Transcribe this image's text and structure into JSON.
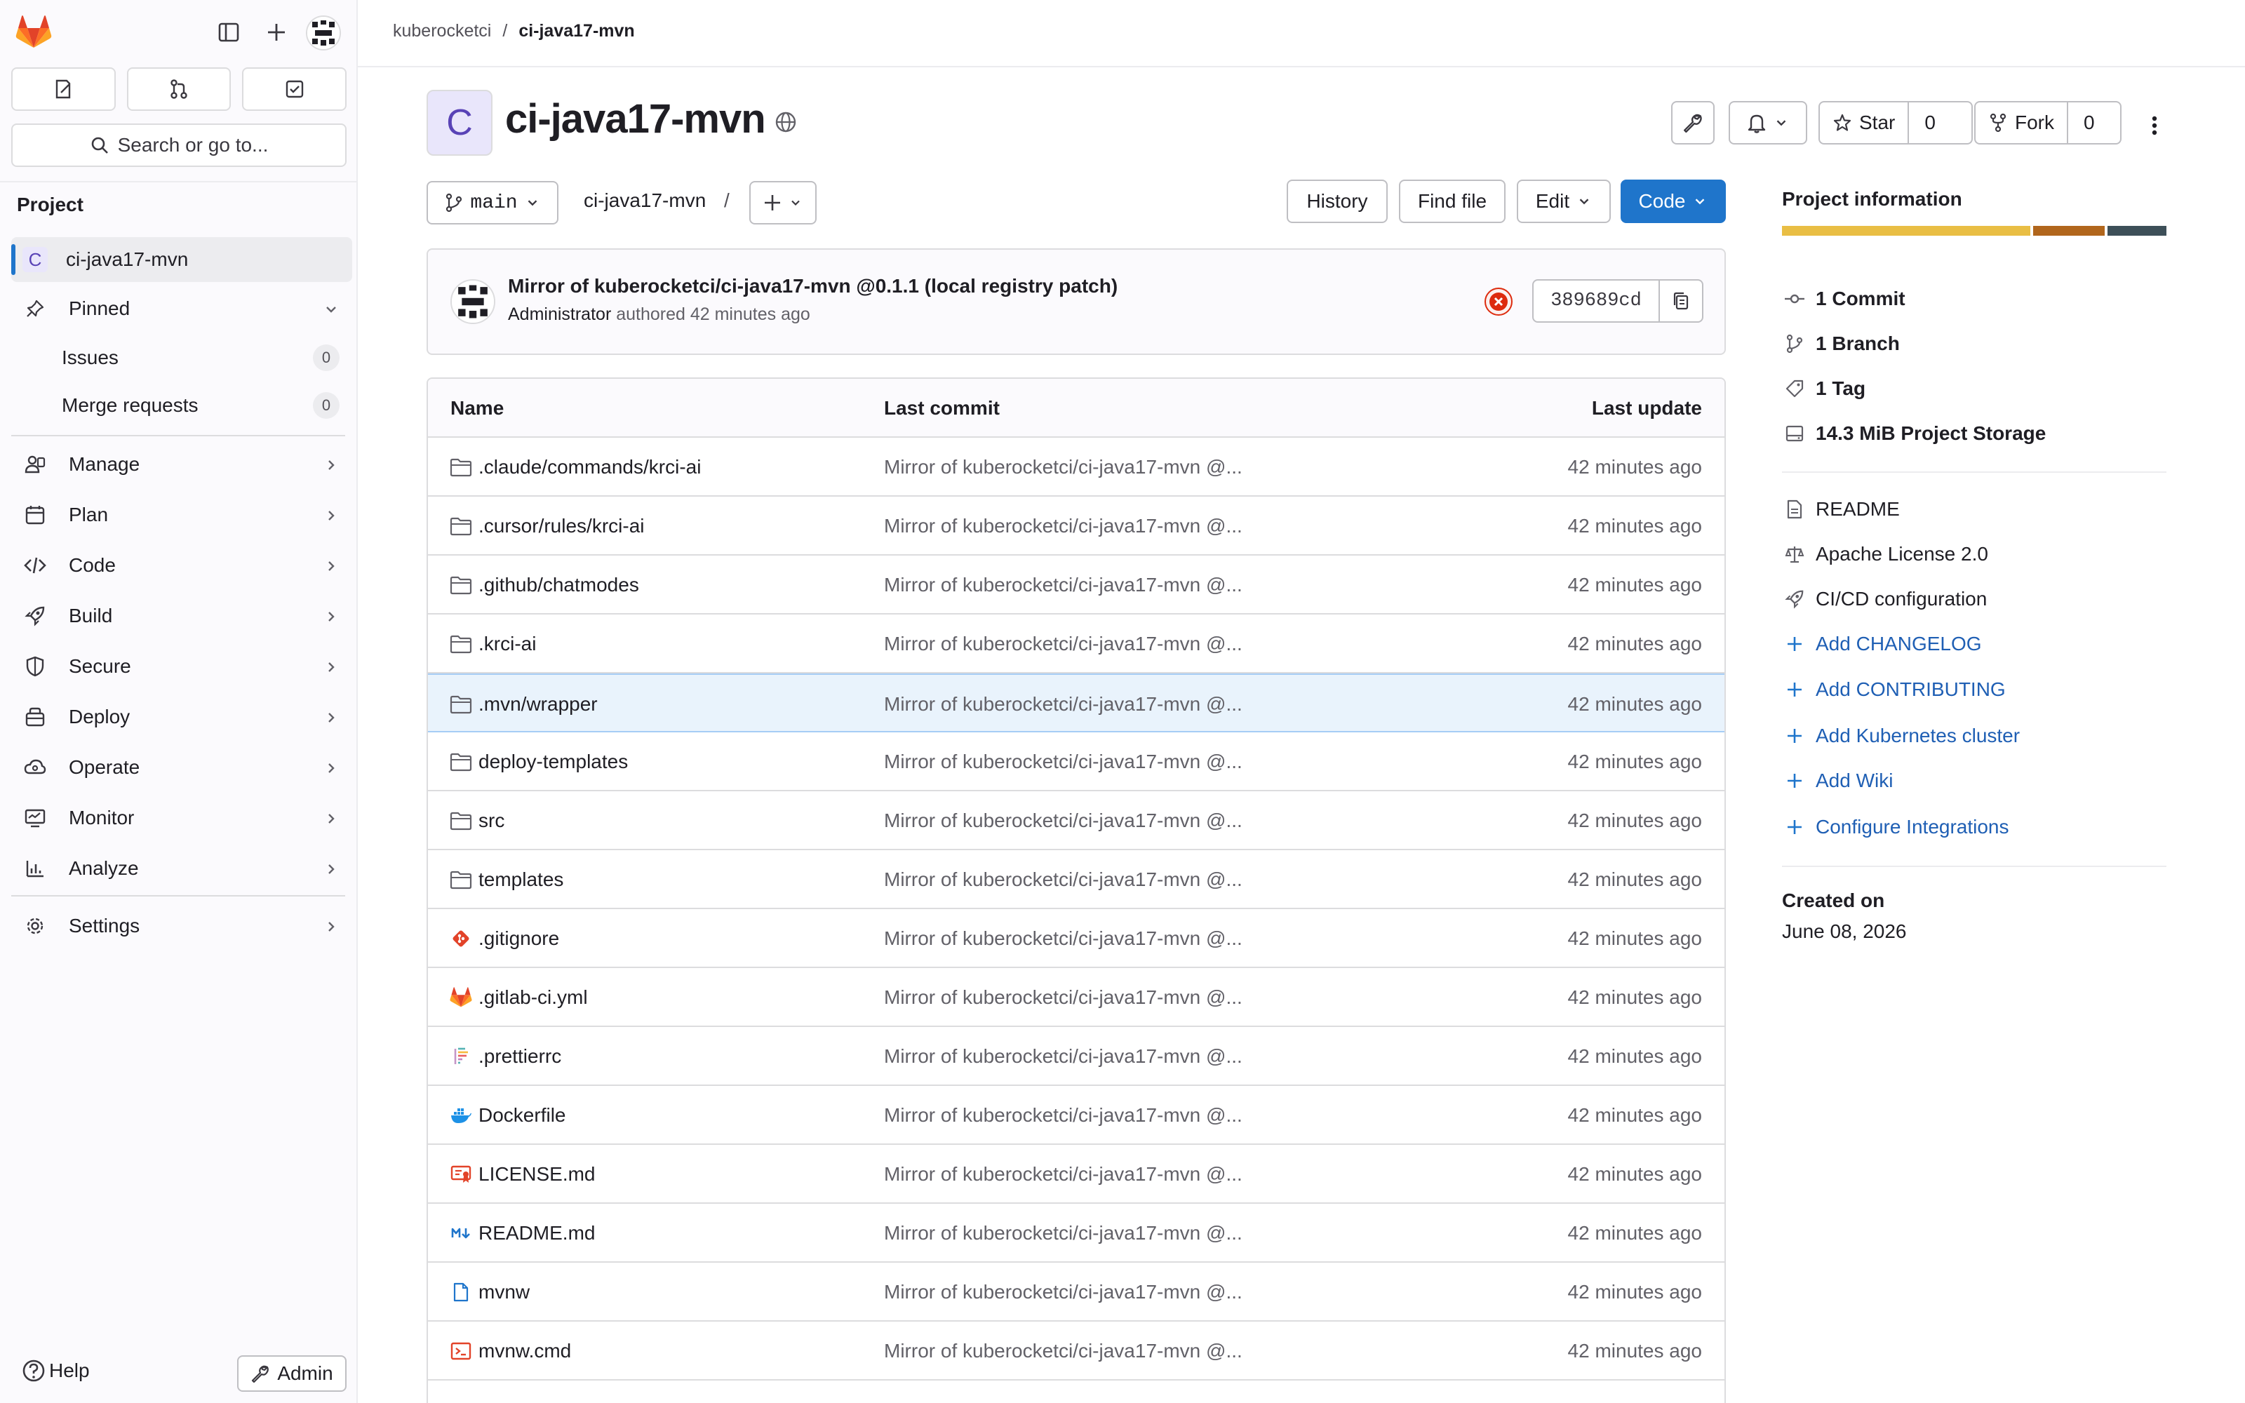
{
  "sidebar": {
    "search_label": "Search or go to...",
    "section_title": "Project",
    "project_initial": "C",
    "project_name": "ci-java17-mvn",
    "pinned_label": "Pinned",
    "pinned": [
      {
        "label": "Issues",
        "count": "0"
      },
      {
        "label": "Merge requests",
        "count": "0"
      }
    ],
    "nav": [
      {
        "label": "Manage",
        "icon": "users-icon"
      },
      {
        "label": "Plan",
        "icon": "calendar-icon"
      },
      {
        "label": "Code",
        "icon": "code-icon"
      },
      {
        "label": "Build",
        "icon": "rocket-icon"
      },
      {
        "label": "Secure",
        "icon": "shield-icon"
      },
      {
        "label": "Deploy",
        "icon": "deployments-icon"
      },
      {
        "label": "Operate",
        "icon": "cloud-gear-icon"
      },
      {
        "label": "Monitor",
        "icon": "monitor-icon"
      },
      {
        "label": "Analyze",
        "icon": "chart-icon"
      }
    ],
    "settings_label": "Settings",
    "help_label": "Help",
    "admin_label": "Admin"
  },
  "breadcrumb": {
    "group": "kuberocketci",
    "separator": "/",
    "project": "ci-java17-mvn"
  },
  "project": {
    "initial": "C",
    "title": "ci-java17-mvn",
    "star_label": "Star",
    "star_count": "0",
    "fork_label": "Fork",
    "fork_count": "0"
  },
  "toolbar": {
    "branch": "main",
    "path": "ci-java17-mvn",
    "path_sep": "/",
    "history": "History",
    "find_file": "Find file",
    "edit": "Edit",
    "code": "Code"
  },
  "commit": {
    "title": "Mirror of kuberocketci/ci-java17-mvn @0.1.1 (local registry patch)",
    "author": "Administrator",
    "meta": "authored 42 minutes ago",
    "sha": "389689cd",
    "status_color": "#dd2b0e"
  },
  "tree": {
    "headers": {
      "name": "Name",
      "last_commit": "Last commit",
      "last_update": "Last update"
    },
    "rows": [
      {
        "name": ".claude/commands/krci-ai",
        "icon": "folder-icon",
        "commit": "Mirror of kuberocketci/ci-java17-mvn @...",
        "updated": "42 minutes ago"
      },
      {
        "name": ".cursor/rules/krci-ai",
        "icon": "folder-icon",
        "commit": "Mirror of kuberocketci/ci-java17-mvn @...",
        "updated": "42 minutes ago"
      },
      {
        "name": ".github/chatmodes",
        "icon": "folder-icon",
        "commit": "Mirror of kuberocketci/ci-java17-mvn @...",
        "updated": "42 minutes ago"
      },
      {
        "name": ".krci-ai",
        "icon": "folder-icon",
        "commit": "Mirror of kuberocketci/ci-java17-mvn @...",
        "updated": "42 minutes ago"
      },
      {
        "name": ".mvn/wrapper",
        "icon": "folder-icon",
        "commit": "Mirror of kuberocketci/ci-java17-mvn @...",
        "updated": "42 minutes ago"
      },
      {
        "name": "deploy-templates",
        "icon": "folder-icon",
        "commit": "Mirror of kuberocketci/ci-java17-mvn @...",
        "updated": "42 minutes ago"
      },
      {
        "name": "src",
        "icon": "folder-icon",
        "commit": "Mirror of kuberocketci/ci-java17-mvn @...",
        "updated": "42 minutes ago"
      },
      {
        "name": "templates",
        "icon": "folder-icon",
        "commit": "Mirror of kuberocketci/ci-java17-mvn @...",
        "updated": "42 minutes ago"
      },
      {
        "name": ".gitignore",
        "icon": "git-icon",
        "commit": "Mirror of kuberocketci/ci-java17-mvn @...",
        "updated": "42 minutes ago"
      },
      {
        "name": ".gitlab-ci.yml",
        "icon": "gitlab-icon",
        "commit": "Mirror of kuberocketci/ci-java17-mvn @...",
        "updated": "42 minutes ago"
      },
      {
        "name": ".prettierrc",
        "icon": "prettier-icon",
        "commit": "Mirror of kuberocketci/ci-java17-mvn @...",
        "updated": "42 minutes ago"
      },
      {
        "name": "Dockerfile",
        "icon": "docker-icon",
        "commit": "Mirror of kuberocketci/ci-java17-mvn @...",
        "updated": "42 minutes ago"
      },
      {
        "name": "LICENSE.md",
        "icon": "license-icon",
        "commit": "Mirror of kuberocketci/ci-java17-mvn @...",
        "updated": "42 minutes ago"
      },
      {
        "name": "README.md",
        "icon": "markdown-icon",
        "commit": "Mirror of kuberocketci/ci-java17-mvn @...",
        "updated": "42 minutes ago"
      },
      {
        "name": "mvnw",
        "icon": "file-icon",
        "commit": "Mirror of kuberocketci/ci-java17-mvn @...",
        "updated": "42 minutes ago"
      },
      {
        "name": "mvnw.cmd",
        "icon": "terminal-icon",
        "commit": "Mirror of kuberocketci/ci-java17-mvn @...",
        "updated": "42 minutes ago"
      }
    ]
  },
  "project_info": {
    "title": "Project information",
    "storage_bar_colors": [
      "#e9be44",
      "#b1661c",
      "#3d4f58"
    ],
    "stats": [
      {
        "label": "1 Commit",
        "icon": "commit-icon"
      },
      {
        "label": "1 Branch",
        "icon": "branch-icon"
      },
      {
        "label": "1 Tag",
        "icon": "tag-icon"
      },
      {
        "label": "14.3 MiB Project Storage",
        "icon": "storage-icon"
      }
    ],
    "docs": [
      {
        "label": "README",
        "icon": "doc-icon"
      },
      {
        "label": "Apache License 2.0",
        "icon": "scale-icon"
      },
      {
        "label": "CI/CD configuration",
        "icon": "rocket-icon"
      }
    ],
    "add_links": [
      {
        "label": "Add CHANGELOG"
      },
      {
        "label": "Add CONTRIBUTING"
      },
      {
        "label": "Add Kubernetes cluster"
      },
      {
        "label": "Add Wiki"
      },
      {
        "label": "Configure Integrations"
      }
    ],
    "created_label": "Created on",
    "created_date": "June 08, 2026"
  }
}
